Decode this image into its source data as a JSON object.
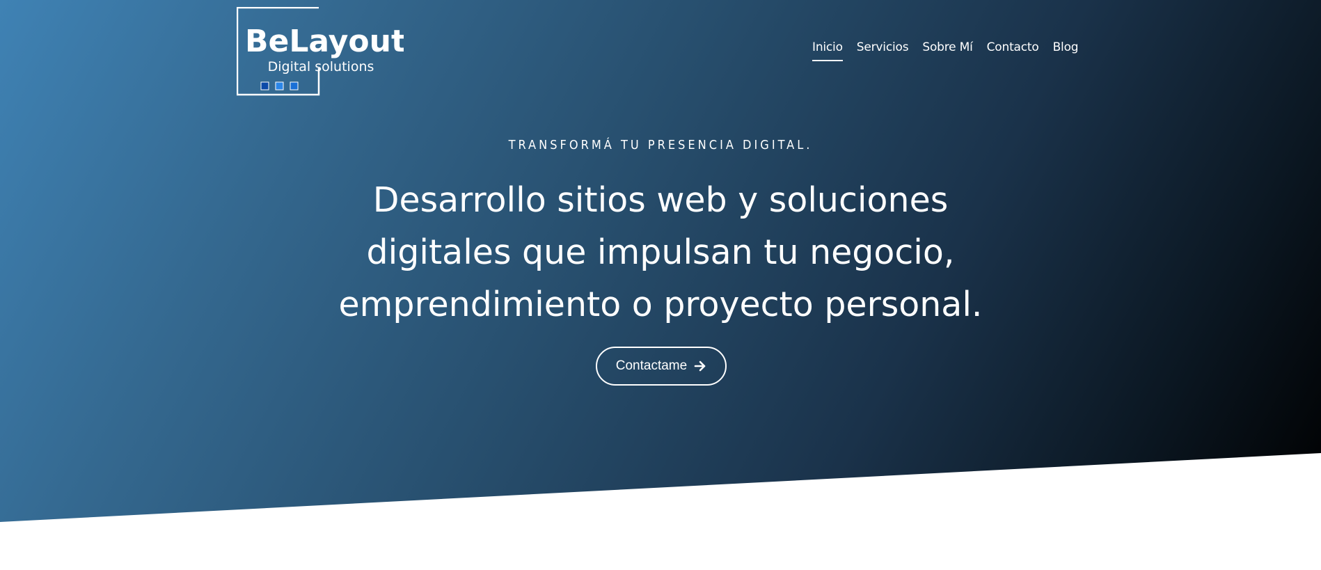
{
  "brand": {
    "name": "BeLayout",
    "tagline": "Digital solutions",
    "colors": {
      "square_1": "#0d4aa8",
      "square_2": "#2b86e8",
      "square_3": "#1a6fd6"
    }
  },
  "nav": {
    "items": [
      {
        "label": "Inicio",
        "active": true
      },
      {
        "label": "Servicios",
        "active": false
      },
      {
        "label": "Sobre Mí",
        "active": false
      },
      {
        "label": "Contacto",
        "active": false
      },
      {
        "label": "Blog",
        "active": false
      }
    ]
  },
  "hero": {
    "kicker": "TRANSFORMÁ TU PRESENCIA DIGITAL.",
    "headline": "Desarrollo sitios web y soluciones digitales que impulsan tu negocio, emprendimiento o proyecto personal.",
    "cta_label": "Contactame",
    "cta_icon": "arrow-right-icon"
  },
  "colors": {
    "gradient_start": "#3f82b4",
    "gradient_end": "#000000",
    "text": "#ffffff",
    "page_background": "#ffffff"
  }
}
